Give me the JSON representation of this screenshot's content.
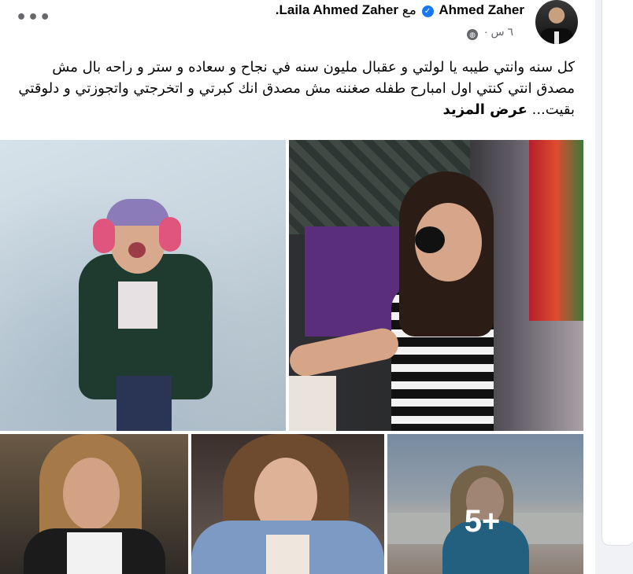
{
  "post": {
    "author": "Ahmed Zaher",
    "with_word": "مع",
    "tagged": "Laila Ahmed Zaher.",
    "time": "٦ س",
    "dot": "·",
    "text": "كل سنه وانتي طيبه يا لولتي و عقبال مليون سنه في نجاح و سعاده و ستر و راحه بال مش مصدق انتي كنتي اول امبارح طفله صغننه مش مصدق انك كبرتي و اتخرجتي واتجوزتي و دلوقتي بقيت...",
    "see_more": "عرض المزيد",
    "more_photos": "5+"
  },
  "icons": {
    "more": "more-horizontal-icon",
    "verified": "verified-badge-icon",
    "audience": "globe-icon"
  },
  "colors": {
    "verified": "#1877f2",
    "meta": "#65676b",
    "text": "#050505"
  }
}
